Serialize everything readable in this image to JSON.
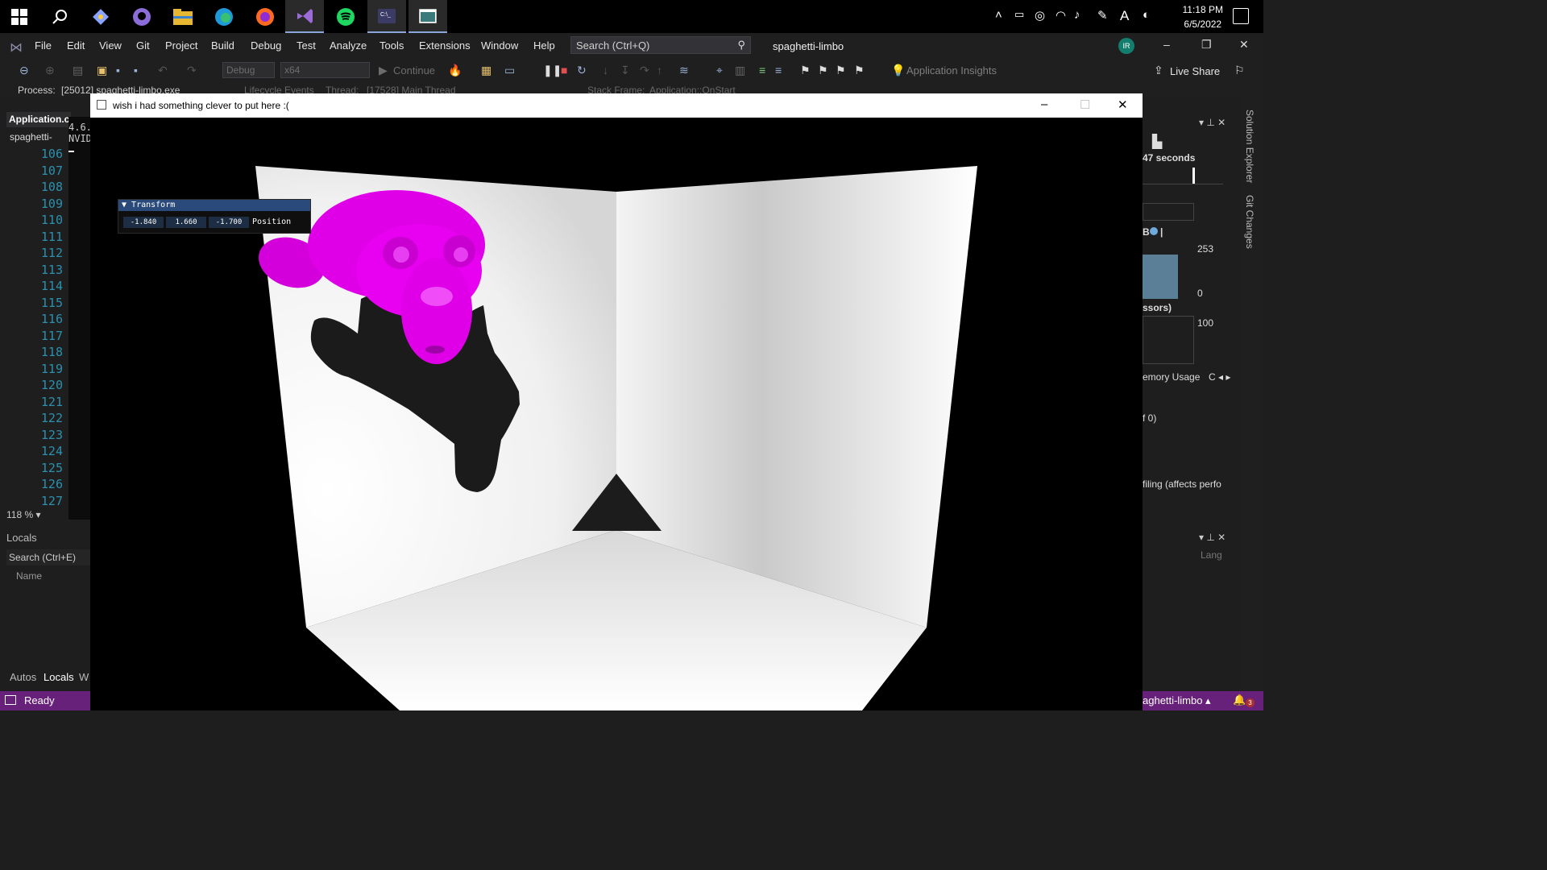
{
  "taskbar": {
    "icons": [
      "windows-icon",
      "search-icon",
      "git-icon",
      "github-icon",
      "file-explorer-icon",
      "edge-icon",
      "firefox-icon",
      "visual-studio-icon",
      "spotify-icon",
      "terminal-icon",
      "app-window-icon"
    ],
    "time": "11:18 PM",
    "date": "6/5/2022",
    "input_indicator": "A"
  },
  "menu": {
    "items": [
      "File",
      "Edit",
      "View",
      "Git",
      "Project",
      "Build",
      "Debug",
      "Test",
      "Analyze",
      "Tools",
      "Extensions",
      "Window",
      "Help"
    ],
    "search_placeholder": "Search (Ctrl+Q)",
    "solution_title": "spaghetti-limbo",
    "avatar_initials": "IR"
  },
  "toolbar": {
    "config": "Debug",
    "platform": "x64",
    "continue_label": "Continue",
    "app_insights": "Application Insights",
    "live_share": "Live Share"
  },
  "debug_bar": {
    "process_label": "Process:",
    "process_value": "[25012] spaghetti-limbo.exe",
    "lifecycle": "Lifecycle Events",
    "thread_label": "Thread:",
    "thread_value": "[17528] Main Thread",
    "stack_label": "Stack Frame:",
    "stack_value": "Application::OnStart"
  },
  "editor": {
    "tab_title": "Application.c",
    "file_label": "spaghetti-",
    "line_numbers": [
      "106",
      "107",
      "108",
      "109",
      "110",
      "111",
      "112",
      "113",
      "114",
      "115",
      "116",
      "117",
      "118",
      "119",
      "120",
      "121",
      "122",
      "123",
      "124",
      "125",
      "126",
      "127"
    ],
    "console_lines": [
      "4.6.",
      "NVID"
    ],
    "zoom": "118 %"
  },
  "locals": {
    "title": "Locals",
    "search": "Search (Ctrl+E)",
    "column_name": "Name",
    "tabs": [
      "Autos",
      "Locals",
      "W"
    ]
  },
  "right_panel": {
    "seconds": "47 seconds",
    "value_253": "253",
    "value_0": "0",
    "cpu_label": "ssors)",
    "value_100": "100",
    "memory_tab": "emory Usage",
    "of_zero": "f 0)",
    "profiling": "filing (affects perfo",
    "lang": "Lang",
    "side_tabs": [
      "Solution Explorer",
      "Git Changes"
    ]
  },
  "status": {
    "ready": "Ready",
    "project": "aghetti-limbo",
    "notification_count": "3"
  },
  "app_window": {
    "title": "wish i had something clever to put here :(",
    "transform": {
      "header": "Transform",
      "x": "-1.840",
      "y": "1.660",
      "z": "-1.700",
      "label": "Position"
    }
  },
  "colors": {
    "accent_purple": "#68217a",
    "monkey_magenta": "#e000e8",
    "line_number_blue": "#2b91af"
  }
}
